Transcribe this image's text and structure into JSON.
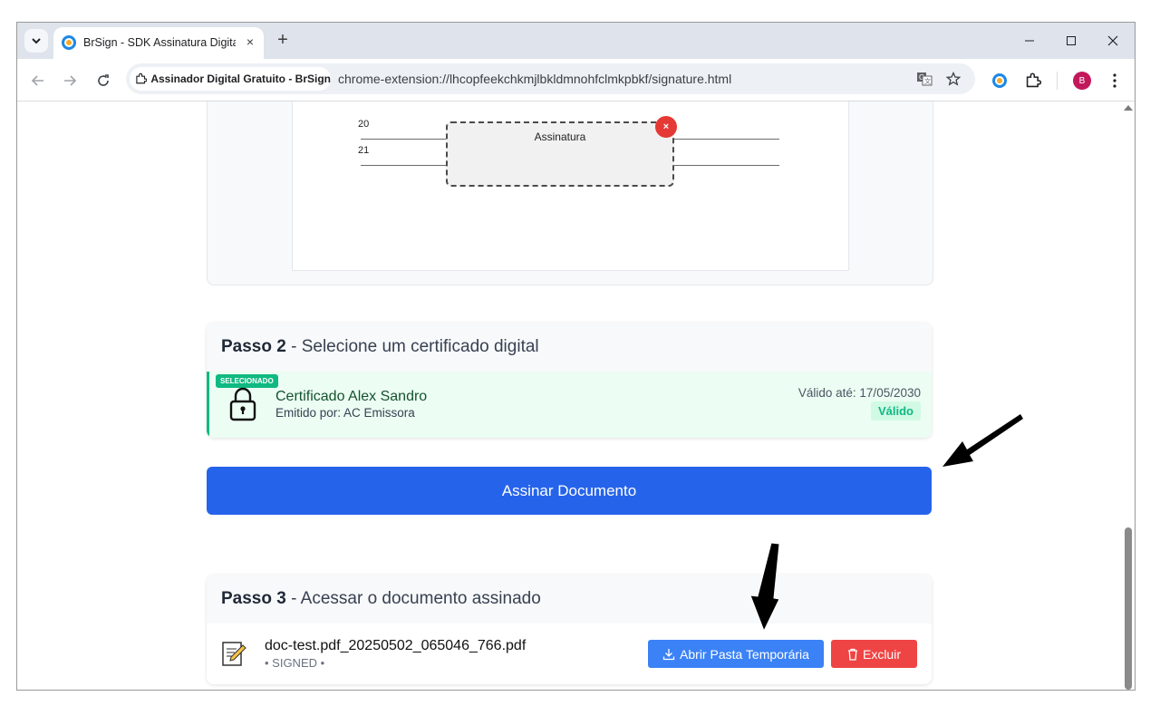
{
  "browser": {
    "tab_title": "BrSign - SDK Assinatura Digital",
    "tab_close": "×",
    "new_tab": "+",
    "site_chip": "Assinador Digital Gratuito - BrSign",
    "url": "chrome-extension://lhcopfeekchkmjlbkldmnohfclmkpbkf/signature.html",
    "profile_initial": "B"
  },
  "document_preview": {
    "line_numbers": [
      "20",
      "21"
    ],
    "signature_label": "Assinatura",
    "signature_close": "×"
  },
  "step2": {
    "step": "Passo 2",
    "title": " - Selecione um certificado digital",
    "certificate": {
      "badge": "SELECIONADO",
      "name": "Certificado Alex Sandro",
      "issuer": "Emitido por: AC Emissora",
      "valid_until": "Válido até: 17/05/2030",
      "status": "Válido"
    }
  },
  "sign_button": "Assinar Documento",
  "step3": {
    "step": "Passo 3",
    "title": " - Acessar o documento assinado",
    "document": {
      "name": "doc-test.pdf_20250502_065046_766.pdf",
      "status": "• SIGNED •",
      "open_button": "Abrir Pasta Temporária",
      "delete_button": "Excluir"
    }
  },
  "colors": {
    "primary": "#2563eb",
    "open_button": "#3b82f6",
    "delete_button": "#ef4444",
    "selected": "#10b981"
  }
}
